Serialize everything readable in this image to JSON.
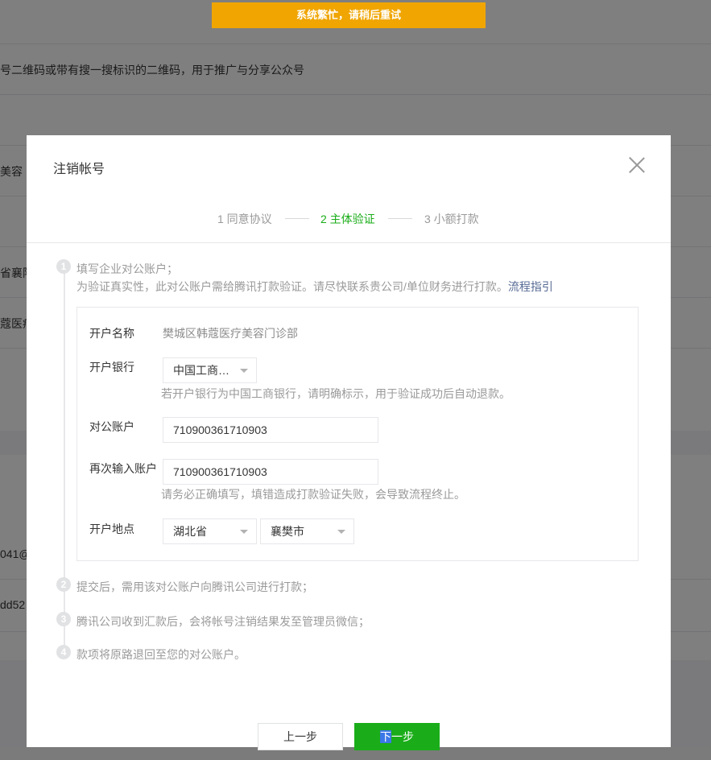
{
  "background": {
    "row1_text": "号二维码或带有搜一搜标识的二维码，用于推广与分享公众号",
    "row2_text": "美容",
    "row3_text": "省襄阳",
    "row4_text": "蔻医疗",
    "row5_text": "041@",
    "row6_text": "dd52"
  },
  "toast": {
    "text": "系统繁忙，请稍后重试"
  },
  "dialog": {
    "title": "注销帐号",
    "steps": [
      {
        "label": "1 同意协议",
        "active": false
      },
      {
        "label": "2 主体验证",
        "active": true
      },
      {
        "label": "3 小额打款",
        "active": false
      }
    ],
    "step1": {
      "number": "1",
      "title": "填写企业对公账户；",
      "desc": "为验证真实性，此对公账户需给腾讯打款验证。请尽快联系贵公司/单位财务进行打款。",
      "link": "流程指引"
    },
    "form": {
      "name_label": "开户名称",
      "name_value": "樊城区韩蔻医疗美容门诊部",
      "bank_label": "开户银行",
      "bank_value": "中国工商…",
      "bank_hint": "若开户银行为中国工商银行，请明确标示，用于验证成功后自动退款。",
      "account_label": "对公账户",
      "account_value": "710900361710903",
      "account2_label": "再次输入账户",
      "account2_value": "710900361710903",
      "account_hint": "请务必正确填写，填错造成打款验证失败，会导致流程终止。",
      "location_label": "开户地点",
      "province_value": "湖北省",
      "city_value": "襄樊市"
    },
    "step2": {
      "number": "2",
      "text": "提交后，需用该对公账户向腾讯公司进行打款；"
    },
    "step3": {
      "number": "3",
      "text": "腾讯公司收到汇款后，会将帐号注销结果发至管理员微信；"
    },
    "step4": {
      "number": "4",
      "text": "款项将原路退回至您的对公账户。"
    },
    "buttons": {
      "prev": "上一步",
      "next_selected": "下",
      "next_rest": "一步"
    }
  },
  "colors": {
    "primary": "#1aad19",
    "toast": "#f0a500",
    "link": "#576b95"
  }
}
